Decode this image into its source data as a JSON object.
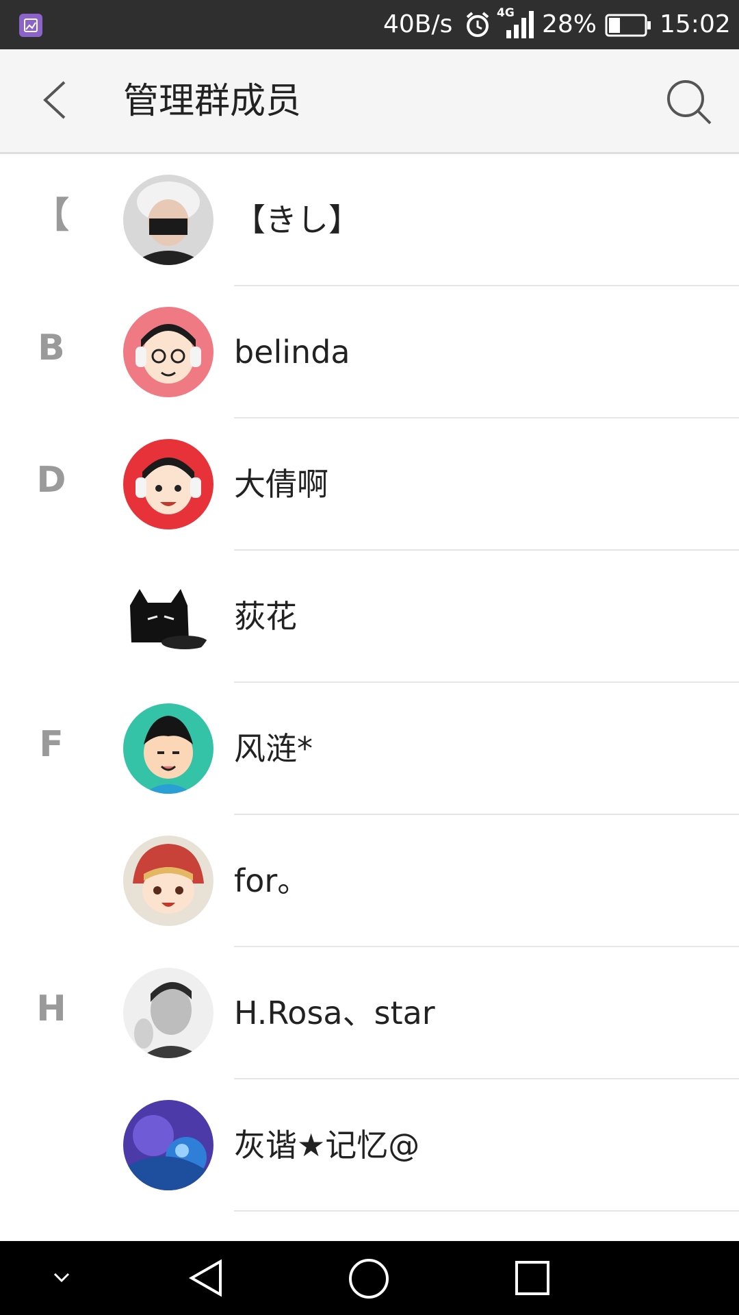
{
  "status_bar": {
    "speed": "40B/s",
    "network": "4G",
    "battery": "28%",
    "time": "15:02"
  },
  "app_bar": {
    "title": "管理群成员",
    "back_icon": "chevron-left-icon",
    "search_icon": "search-icon"
  },
  "members": [
    {
      "section": "【",
      "name": "【きし】",
      "avatar": "masked-character"
    },
    {
      "section": "B",
      "name": "belinda",
      "avatar": "cartoon-headphones-pink"
    },
    {
      "section": "D",
      "name": "大倩啊",
      "avatar": "cartoon-headphones-red"
    },
    {
      "section": "",
      "name": "荻花",
      "avatar": "black-cat"
    },
    {
      "section": "F",
      "name": "风涟*",
      "avatar": "cartoon-boy-teal"
    },
    {
      "section": "",
      "name": "for。",
      "avatar": "anime-girl-hood"
    },
    {
      "section": "H",
      "name": "H.Rosa、star",
      "avatar": "portrait-man"
    },
    {
      "section": "",
      "name": "灰谐★记忆@",
      "avatar": "purple-flower"
    }
  ],
  "nav_bar": {
    "hide_icon": "chevron-down-icon",
    "back_icon": "triangle-back-icon",
    "home_icon": "circle-home-icon",
    "recents_icon": "square-recents-icon"
  },
  "colors": {
    "status_bar_bg": "#2f2f2f",
    "app_bar_bg": "#f5f5f5",
    "section_letter": "#9a9a9a",
    "nav_bar_bg": "#000000"
  }
}
